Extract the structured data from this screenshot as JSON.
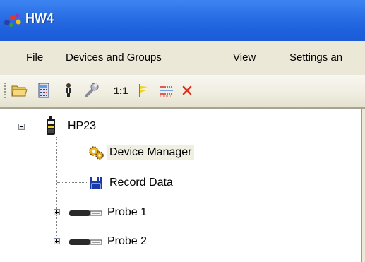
{
  "window": {
    "title": "HW4",
    "accent_color": "#2a6fe6"
  },
  "menu": {
    "items": [
      "File",
      "Devices and Groups",
      "View",
      "Settings an"
    ]
  },
  "toolbar": {
    "buttons": [
      {
        "icon": "open-folder-icon"
      },
      {
        "icon": "calculator-icon"
      },
      {
        "icon": "person-icon"
      },
      {
        "icon": "wrench-icon"
      },
      {
        "icon": "actual-size-icon",
        "label": "1:1"
      },
      {
        "icon": "flag-icon"
      },
      {
        "icon": "hatched-lines-icon"
      },
      {
        "icon": "delete-x-icon"
      }
    ]
  },
  "tree": {
    "root": {
      "label": "HP23",
      "icon": "handheld-device-icon",
      "expanded": true
    },
    "children": [
      {
        "label": "Device Manager",
        "icon": "gears-icon",
        "selected": true
      },
      {
        "label": "Record Data",
        "icon": "floppy-disk-icon"
      },
      {
        "label": "Probe 1",
        "icon": "probe-icon",
        "expandable": true
      },
      {
        "label": "Probe 2",
        "icon": "probe-icon",
        "expandable": true
      }
    ]
  }
}
